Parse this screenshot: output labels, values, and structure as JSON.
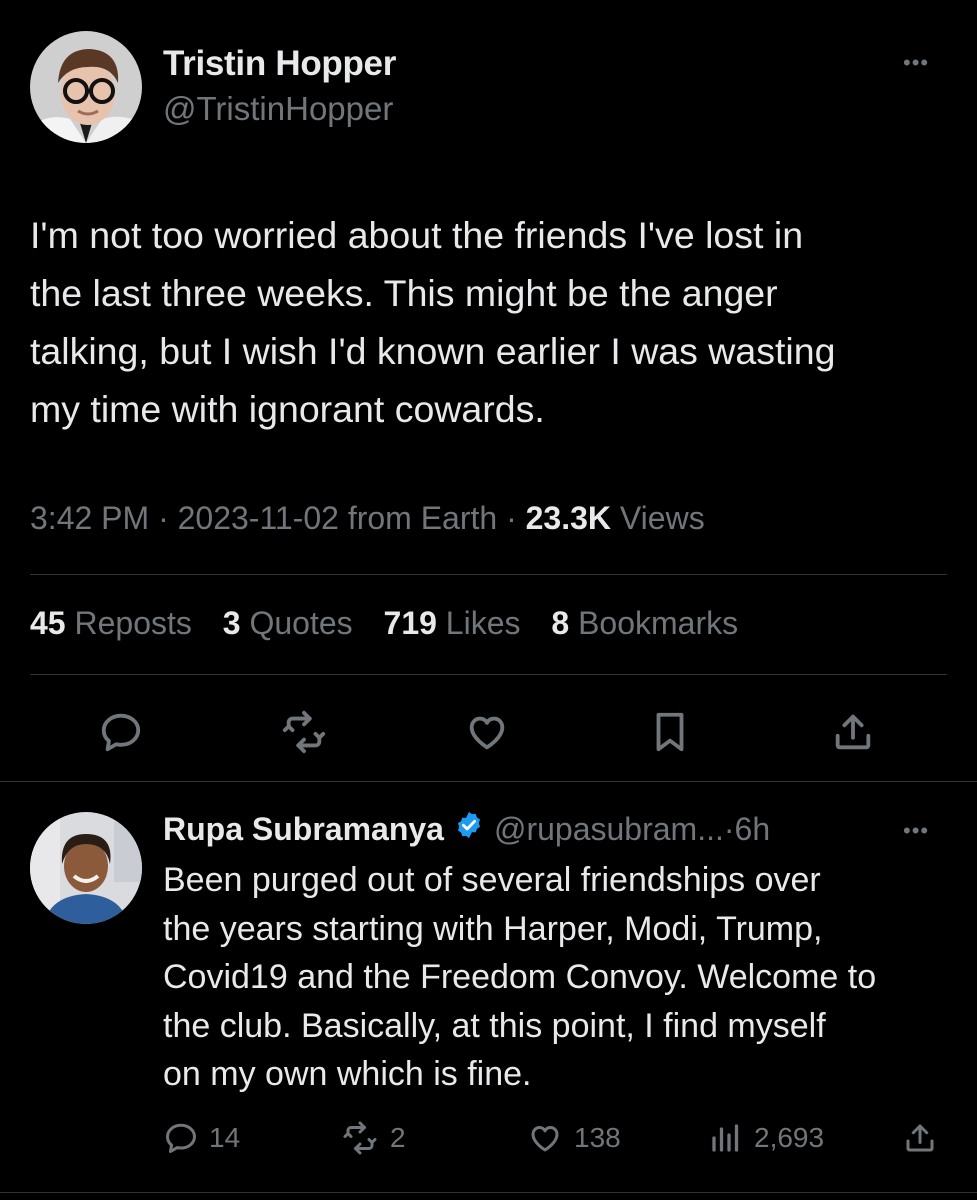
{
  "main_tweet": {
    "author_name": "Tristin Hopper",
    "author_handle": "@TristinHopper",
    "text_lines": [
      "I'm not too worried about the friends I've lost in",
      "the last three weeks. This might be the anger",
      "talking, but I wish I'd known earlier I was wasting",
      "my time with ignorant cowards."
    ],
    "time": "3:42 PM",
    "date": "2023-11-02",
    "location": "from Earth",
    "views_count": "23.3K",
    "views_label": "Views",
    "stats": {
      "reposts_count": "45",
      "reposts_label": "Reposts",
      "quotes_count": "3",
      "quotes_label": "Quotes",
      "likes_count": "719",
      "likes_label": "Likes",
      "bookmarks_count": "8",
      "bookmarks_label": "Bookmarks"
    },
    "actions": [
      "reply-icon",
      "repost-icon",
      "like-icon",
      "bookmark-icon",
      "share-icon"
    ]
  },
  "reply_tweet": {
    "author_name": "Rupa Subramanya",
    "verified": true,
    "author_handle": "@rupasubram...",
    "age": "6h",
    "text_lines": [
      "Been purged out of several friendships over",
      "the years starting with Harper, Modi, Trump,",
      "Covid19 and the Freedom Convoy. Welcome to",
      "the club. Basically, at this point, I find myself",
      "on my own which is fine."
    ],
    "replies": "14",
    "reposts": "2",
    "likes": "138",
    "views": "2,693"
  },
  "colors": {
    "background": "#000000",
    "primary_text": "#e7e9ea",
    "secondary_text": "#71767b",
    "divider": "#2f3336",
    "verified_blue": "#1d9bf0"
  }
}
